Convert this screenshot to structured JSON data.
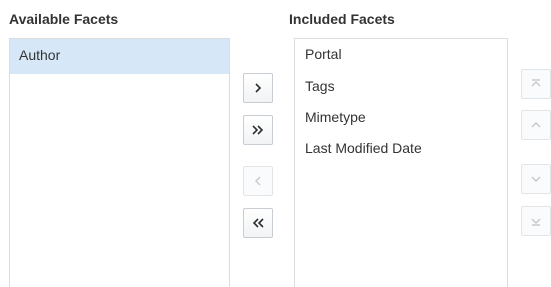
{
  "available": {
    "heading": "Available Facets",
    "items": [
      {
        "label": "Author",
        "selected": true
      }
    ]
  },
  "included": {
    "heading": "Included Facets",
    "items": [
      {
        "label": "Portal"
      },
      {
        "label": "Tags"
      },
      {
        "label": "Mimetype"
      },
      {
        "label": "Last Modified Date"
      }
    ]
  },
  "transfer_buttons": {
    "move": {
      "icon": "chevron-right-icon",
      "enabled": true
    },
    "move_all": {
      "icon": "double-chevron-right-icon",
      "enabled": true
    },
    "remove": {
      "icon": "chevron-left-icon",
      "enabled": false
    },
    "remove_all": {
      "icon": "double-chevron-left-icon",
      "enabled": true
    }
  },
  "order_buttons": {
    "move_top": {
      "icon": "move-to-top-icon",
      "enabled": false
    },
    "move_up": {
      "icon": "chevron-up-icon",
      "enabled": false
    },
    "move_down": {
      "icon": "chevron-down-icon",
      "enabled": false
    },
    "move_bottom": {
      "icon": "move-to-bottom-icon",
      "enabled": false
    }
  },
  "colors": {
    "selected_bg": "#d6e8f7",
    "border": "#dcdcdc",
    "text": "#333333",
    "disabled_icon": "#c4c9ce"
  }
}
